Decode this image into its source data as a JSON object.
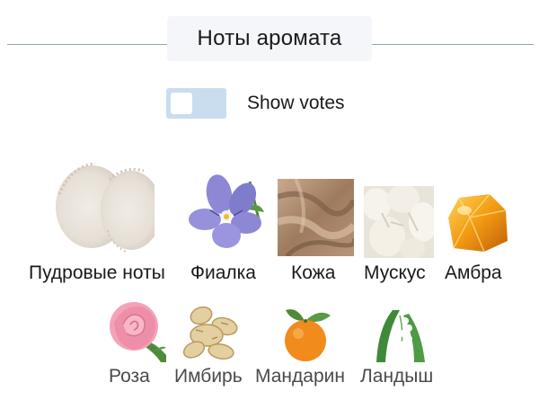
{
  "header": {
    "title": "Ноты аромата"
  },
  "toggle": {
    "label": "Show votes",
    "on": false
  },
  "notes": {
    "row1": [
      {
        "name": "Пудровые ноты",
        "icon": "powder-image"
      },
      {
        "name": "Фиалка",
        "icon": "violet-flower-image"
      },
      {
        "name": "Кожа",
        "icon": "leather-image"
      },
      {
        "name": "Мускус",
        "icon": "musk-image"
      },
      {
        "name": "Амбра",
        "icon": "amber-image"
      }
    ],
    "row2": [
      {
        "name": "Роза",
        "icon": "rose-image"
      },
      {
        "name": "Имбирь",
        "icon": "ginger-image"
      },
      {
        "name": "Мандарин",
        "icon": "mandarin-image"
      },
      {
        "name": "Ландыш",
        "icon": "lily-of-the-valley-image"
      }
    ]
  }
}
